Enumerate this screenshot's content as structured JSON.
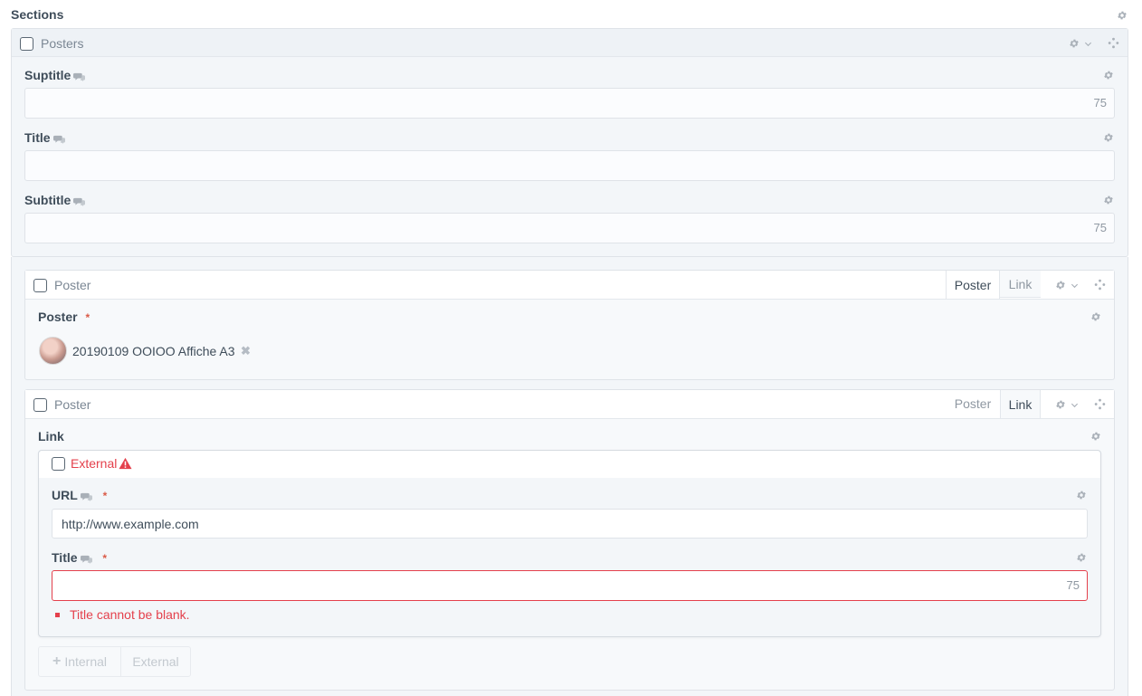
{
  "heading": "Sections",
  "posters_block": {
    "title": "Posters",
    "fields": {
      "suptitle": {
        "label": "Suptitle",
        "value": "",
        "counter": "75"
      },
      "title": {
        "label": "Title",
        "value": ""
      },
      "subtitle": {
        "label": "Subtitle",
        "value": "",
        "counter": "75"
      }
    }
  },
  "poster_block_1": {
    "title": "Poster",
    "tabs": [
      "Poster",
      "Link"
    ],
    "active_tab": "Poster",
    "field_label": "Poster",
    "required_mark": "*",
    "asset": {
      "name": "20190109 OOIOO Affiche A3",
      "remove_icon": "close-icon"
    }
  },
  "poster_block_2": {
    "title": "Poster",
    "tabs": [
      "Poster",
      "Link"
    ],
    "active_tab": "Link",
    "field_label": "Link",
    "external_block": {
      "title": "External",
      "warning_icon": "warning-icon",
      "url": {
        "label": "URL",
        "required_mark": "*",
        "value": "http://www.example.com"
      },
      "title_field": {
        "label": "Title",
        "required_mark": "*",
        "value": "",
        "counter": "75"
      },
      "error": "Title cannot be blank."
    },
    "add_buttons": {
      "internal": "Internal",
      "external": "External"
    }
  },
  "colors": {
    "error": "#e4404c",
    "border": "#dfe3e8",
    "panel": "#f3f6f9",
    "text": "#3f4d5a"
  }
}
